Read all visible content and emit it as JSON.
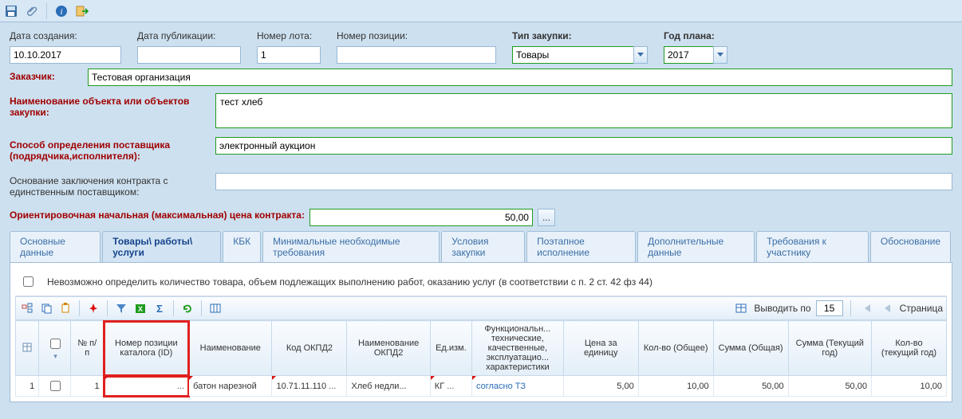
{
  "toolbar": {
    "save": "Сохранить",
    "attach": "Вложения",
    "info": "Информация",
    "exit": "Выход"
  },
  "form": {
    "creation_date": {
      "label": "Дата создания:",
      "value": "10.10.2017"
    },
    "pub_date": {
      "label": "Дата публикации:",
      "value": ""
    },
    "lot_no": {
      "label": "Номер лота:",
      "value": "1"
    },
    "pos_no": {
      "label": "Номер позиции:",
      "value": ""
    },
    "purchase_type": {
      "label": "Тип закупки:",
      "value": "Товары"
    },
    "plan_year": {
      "label": "Год плана:",
      "value": "2017"
    },
    "customer": {
      "label": "Заказчик:",
      "value": "Тестовая организация"
    },
    "object_name": {
      "label": "Наименование объекта или объектов закупки:",
      "value": "тест хлеб"
    },
    "supplier_method": {
      "label": "Способ определения поставщика (подрядчика,исполнителя):",
      "value": "электронный аукцион"
    },
    "single_supplier_basis": {
      "label": "Основание заключения контракта с единственным поставщиком:",
      "value": ""
    },
    "price": {
      "label": "Ориентировочная начальная (максимальная) цена контракта:",
      "value": "50,00",
      "btn": "..."
    }
  },
  "tabs": [
    "Основные данные",
    "Товары\\ работы\\ услуги",
    "КБК",
    "Минимальные необходимые требования",
    "Условия закупки",
    "Поэтапное исполнение",
    "Дополнительные данные",
    "Требования к участнику",
    "Обоснование"
  ],
  "active_tab_index": 1,
  "checkbox_text": "Невозможно определить количество товара, объем подлежащих выполнению работ, оказанию услуг (в соответствии с п. 2 ст. 42 фз 44)",
  "grid_toolbar": {
    "show_by_label": "Выводить по",
    "page_size": "15",
    "page_label": "Страница"
  },
  "grid": {
    "headers": {
      "rownum": "№ п/п",
      "catalog_id": "Номер позиции каталога (ID)",
      "name": "Наименование",
      "okpd2": "Код ОКПД2",
      "okpd2_name": "Наименование ОКПД2",
      "unit": "Ед.изм.",
      "func": "Функциональн... технические, качественные, эксплуатацио... характеристики",
      "price_unit": "Цена за единицу",
      "qty_total": "Кол-во (Общее)",
      "sum_total": "Сумма (Общая)",
      "sum_year": "Сумма (Текущий год)",
      "qty_year": "Кол-во (текущий год)"
    },
    "rows": [
      {
        "n": "1",
        "rownum": "1",
        "catalog_id": "",
        "catalog_btn": "...",
        "name": "батон нарезной",
        "okpd2": "10.71.11.110",
        "okpd2_btn": "...",
        "okpd2_name": "Хлеб недли...",
        "unit": "КГ",
        "unit_btn": "...",
        "func": "согласно ТЗ",
        "price_unit": "5,00",
        "qty_total": "10,00",
        "sum_total": "50,00",
        "sum_year": "50,00",
        "qty_year": "10,00"
      }
    ]
  }
}
